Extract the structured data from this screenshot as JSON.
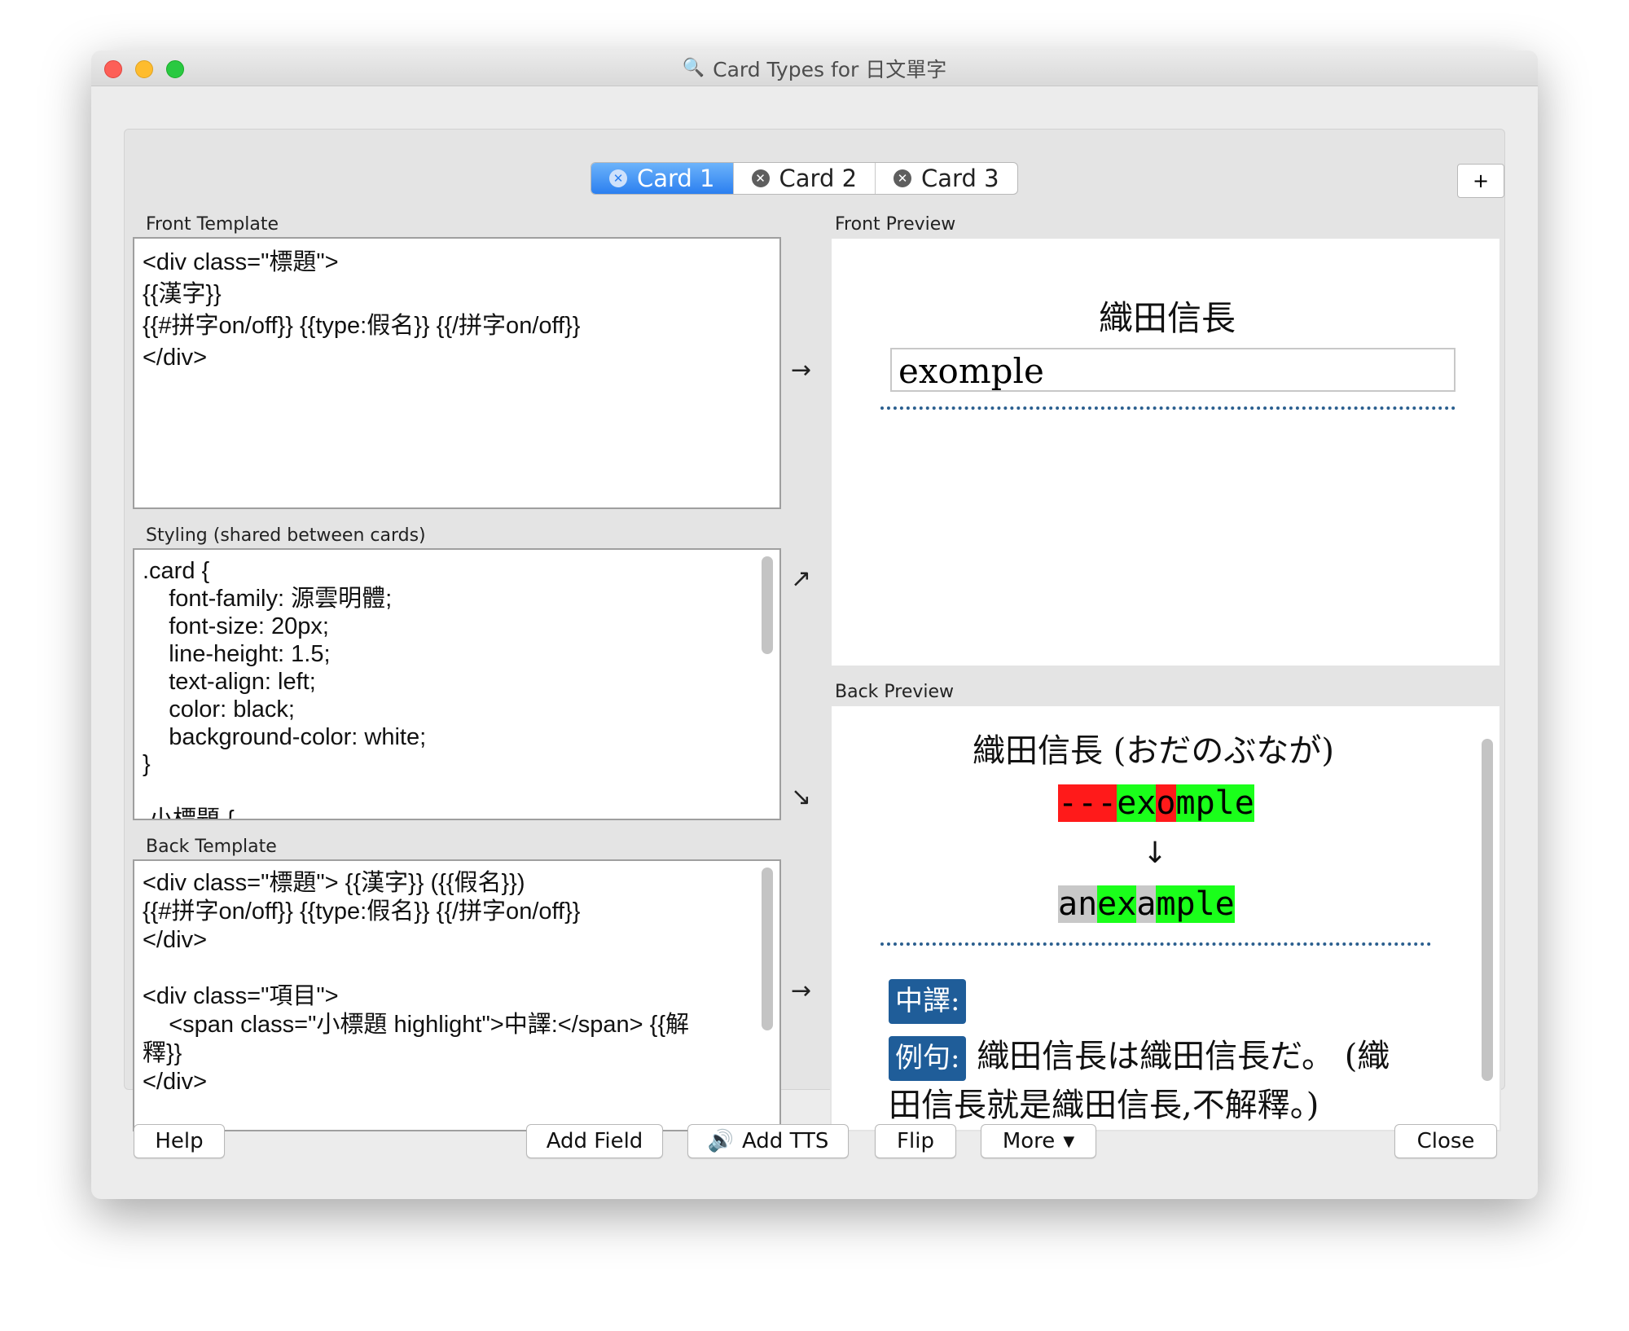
{
  "window": {
    "title": "Card Types for 日文單字"
  },
  "tabs": [
    {
      "label": "Card 1",
      "active": true
    },
    {
      "label": "Card 2",
      "active": false
    },
    {
      "label": "Card 3",
      "active": false
    }
  ],
  "plus_label": "+",
  "labels": {
    "front_template": "Front Template",
    "styling": "Styling (shared between cards)",
    "back_template": "Back Template",
    "front_preview": "Front Preview",
    "back_preview": "Back Preview"
  },
  "front_template": {
    "lines": [
      "<div class=\"標題\">",
      "{{漢字}}",
      "{{#拼字on/off}} {{type:假名}} {{/拼字on/off}}",
      "</div>"
    ]
  },
  "styling": {
    "lines": [
      ".card {",
      "    font-family: 源雲明體;",
      "    font-size: 20px;",
      "    line-height: 1.5;",
      "    text-align: left;",
      "    color: black;",
      "    background-color: white;",
      "}",
      "",
      ".小標題 {"
    ]
  },
  "back_template": {
    "lines": [
      "<div class=\"標題\"> {{漢字}} ({{假名}})",
      "{{#拼字on/off}} {{type:假名}} {{/拼字on/off}}",
      "</div>",
      "",
      "<div class=\"項目\">",
      "    <span class=\"小標題 highlight\">中譯:</span> {{解",
      "釋}}",
      "</div>"
    ]
  },
  "arrows": {
    "front": "→",
    "styling_up": "↗",
    "styling_down": "↘",
    "back": "→"
  },
  "front_preview": {
    "title": "織田信長",
    "answer": "exomple"
  },
  "back_preview": {
    "title": "織田信長 (おだのぶなが)",
    "typed": [
      {
        "text": "---",
        "state": "red"
      },
      {
        "text": "ex",
        "state": "green"
      },
      {
        "text": "o",
        "state": "red"
      },
      {
        "text": "mple",
        "state": "green"
      }
    ],
    "down_arrow": "↓",
    "correct": [
      {
        "text": "an ",
        "state": "gray"
      },
      {
        "text": "ex",
        "state": "green"
      },
      {
        "text": "a",
        "state": "gray"
      },
      {
        "text": "mple",
        "state": "green"
      }
    ],
    "translation_badge": "中譯:",
    "example_badge": "例句:",
    "example_text": "織田信長は織田信長だ。 (織",
    "example_text_2": "田信長就是織田信長,不解釋。)"
  },
  "buttons": {
    "help": "Help",
    "add_field": "Add Field",
    "add_tts": "Add TTS",
    "flip": "Flip",
    "more": "More",
    "close": "Close"
  },
  "colors": {
    "active_tab": "#2b7ff0",
    "diff_red": "#ff1a1a",
    "diff_green": "#1aff1a",
    "diff_gray": "#c8c8c8",
    "badge_blue": "#1f5d99",
    "dotted_rule": "#2b5f8f"
  }
}
